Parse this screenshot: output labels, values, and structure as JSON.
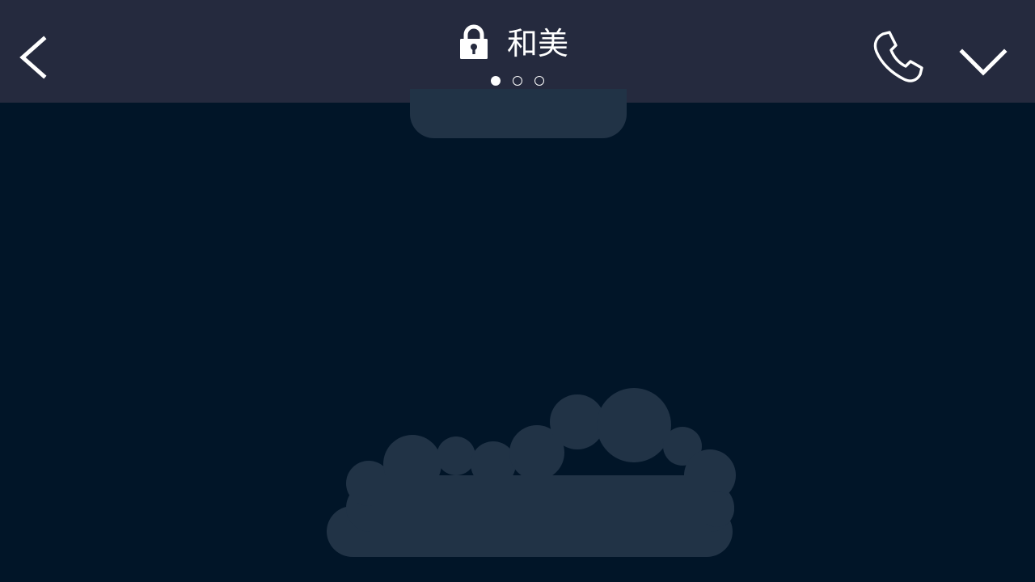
{
  "header": {
    "title": "和美",
    "page_indicator": {
      "total": 3,
      "active_index": 0
    }
  },
  "icons": {
    "back": "chevron-left-icon",
    "lock": "lock-icon",
    "call": "phone-icon",
    "collapse": "chevron-down-icon"
  },
  "colors": {
    "header_background": "#252a3e",
    "chat_background": "#011528",
    "bubble_fill": "#213346",
    "icon_foreground": "#ffffff"
  }
}
